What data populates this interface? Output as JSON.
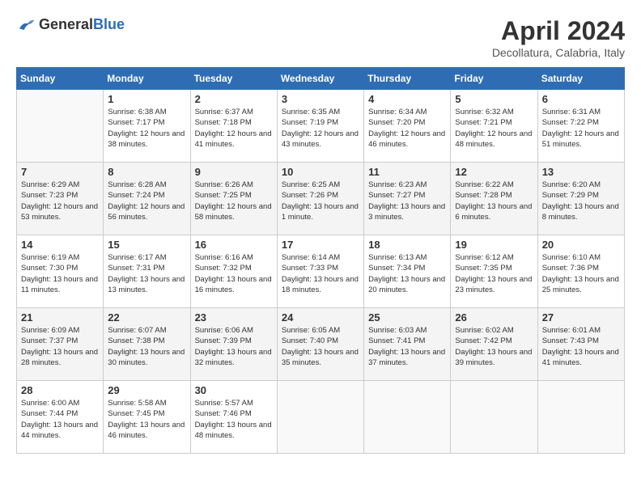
{
  "header": {
    "logo_general": "General",
    "logo_blue": "Blue",
    "title": "April 2024",
    "location": "Decollatura, Calabria, Italy"
  },
  "weekdays": [
    "Sunday",
    "Monday",
    "Tuesday",
    "Wednesday",
    "Thursday",
    "Friday",
    "Saturday"
  ],
  "weeks": [
    [
      {
        "day": "",
        "empty": true
      },
      {
        "day": "1",
        "sunrise": "Sunrise: 6:38 AM",
        "sunset": "Sunset: 7:17 PM",
        "daylight": "Daylight: 12 hours and 38 minutes."
      },
      {
        "day": "2",
        "sunrise": "Sunrise: 6:37 AM",
        "sunset": "Sunset: 7:18 PM",
        "daylight": "Daylight: 12 hours and 41 minutes."
      },
      {
        "day": "3",
        "sunrise": "Sunrise: 6:35 AM",
        "sunset": "Sunset: 7:19 PM",
        "daylight": "Daylight: 12 hours and 43 minutes."
      },
      {
        "day": "4",
        "sunrise": "Sunrise: 6:34 AM",
        "sunset": "Sunset: 7:20 PM",
        "daylight": "Daylight: 12 hours and 46 minutes."
      },
      {
        "day": "5",
        "sunrise": "Sunrise: 6:32 AM",
        "sunset": "Sunset: 7:21 PM",
        "daylight": "Daylight: 12 hours and 48 minutes."
      },
      {
        "day": "6",
        "sunrise": "Sunrise: 6:31 AM",
        "sunset": "Sunset: 7:22 PM",
        "daylight": "Daylight: 12 hours and 51 minutes."
      }
    ],
    [
      {
        "day": "7",
        "sunrise": "Sunrise: 6:29 AM",
        "sunset": "Sunset: 7:23 PM",
        "daylight": "Daylight: 12 hours and 53 minutes."
      },
      {
        "day": "8",
        "sunrise": "Sunrise: 6:28 AM",
        "sunset": "Sunset: 7:24 PM",
        "daylight": "Daylight: 12 hours and 56 minutes."
      },
      {
        "day": "9",
        "sunrise": "Sunrise: 6:26 AM",
        "sunset": "Sunset: 7:25 PM",
        "daylight": "Daylight: 12 hours and 58 minutes."
      },
      {
        "day": "10",
        "sunrise": "Sunrise: 6:25 AM",
        "sunset": "Sunset: 7:26 PM",
        "daylight": "Daylight: 13 hours and 1 minute."
      },
      {
        "day": "11",
        "sunrise": "Sunrise: 6:23 AM",
        "sunset": "Sunset: 7:27 PM",
        "daylight": "Daylight: 13 hours and 3 minutes."
      },
      {
        "day": "12",
        "sunrise": "Sunrise: 6:22 AM",
        "sunset": "Sunset: 7:28 PM",
        "daylight": "Daylight: 13 hours and 6 minutes."
      },
      {
        "day": "13",
        "sunrise": "Sunrise: 6:20 AM",
        "sunset": "Sunset: 7:29 PM",
        "daylight": "Daylight: 13 hours and 8 minutes."
      }
    ],
    [
      {
        "day": "14",
        "sunrise": "Sunrise: 6:19 AM",
        "sunset": "Sunset: 7:30 PM",
        "daylight": "Daylight: 13 hours and 11 minutes."
      },
      {
        "day": "15",
        "sunrise": "Sunrise: 6:17 AM",
        "sunset": "Sunset: 7:31 PM",
        "daylight": "Daylight: 13 hours and 13 minutes."
      },
      {
        "day": "16",
        "sunrise": "Sunrise: 6:16 AM",
        "sunset": "Sunset: 7:32 PM",
        "daylight": "Daylight: 13 hours and 16 minutes."
      },
      {
        "day": "17",
        "sunrise": "Sunrise: 6:14 AM",
        "sunset": "Sunset: 7:33 PM",
        "daylight": "Daylight: 13 hours and 18 minutes."
      },
      {
        "day": "18",
        "sunrise": "Sunrise: 6:13 AM",
        "sunset": "Sunset: 7:34 PM",
        "daylight": "Daylight: 13 hours and 20 minutes."
      },
      {
        "day": "19",
        "sunrise": "Sunrise: 6:12 AM",
        "sunset": "Sunset: 7:35 PM",
        "daylight": "Daylight: 13 hours and 23 minutes."
      },
      {
        "day": "20",
        "sunrise": "Sunrise: 6:10 AM",
        "sunset": "Sunset: 7:36 PM",
        "daylight": "Daylight: 13 hours and 25 minutes."
      }
    ],
    [
      {
        "day": "21",
        "sunrise": "Sunrise: 6:09 AM",
        "sunset": "Sunset: 7:37 PM",
        "daylight": "Daylight: 13 hours and 28 minutes."
      },
      {
        "day": "22",
        "sunrise": "Sunrise: 6:07 AM",
        "sunset": "Sunset: 7:38 PM",
        "daylight": "Daylight: 13 hours and 30 minutes."
      },
      {
        "day": "23",
        "sunrise": "Sunrise: 6:06 AM",
        "sunset": "Sunset: 7:39 PM",
        "daylight": "Daylight: 13 hours and 32 minutes."
      },
      {
        "day": "24",
        "sunrise": "Sunrise: 6:05 AM",
        "sunset": "Sunset: 7:40 PM",
        "daylight": "Daylight: 13 hours and 35 minutes."
      },
      {
        "day": "25",
        "sunrise": "Sunrise: 6:03 AM",
        "sunset": "Sunset: 7:41 PM",
        "daylight": "Daylight: 13 hours and 37 minutes."
      },
      {
        "day": "26",
        "sunrise": "Sunrise: 6:02 AM",
        "sunset": "Sunset: 7:42 PM",
        "daylight": "Daylight: 13 hours and 39 minutes."
      },
      {
        "day": "27",
        "sunrise": "Sunrise: 6:01 AM",
        "sunset": "Sunset: 7:43 PM",
        "daylight": "Daylight: 13 hours and 41 minutes."
      }
    ],
    [
      {
        "day": "28",
        "sunrise": "Sunrise: 6:00 AM",
        "sunset": "Sunset: 7:44 PM",
        "daylight": "Daylight: 13 hours and 44 minutes."
      },
      {
        "day": "29",
        "sunrise": "Sunrise: 5:58 AM",
        "sunset": "Sunset: 7:45 PM",
        "daylight": "Daylight: 13 hours and 46 minutes."
      },
      {
        "day": "30",
        "sunrise": "Sunrise: 5:57 AM",
        "sunset": "Sunset: 7:46 PM",
        "daylight": "Daylight: 13 hours and 48 minutes."
      },
      {
        "day": "",
        "empty": true
      },
      {
        "day": "",
        "empty": true
      },
      {
        "day": "",
        "empty": true
      },
      {
        "day": "",
        "empty": true
      }
    ]
  ]
}
